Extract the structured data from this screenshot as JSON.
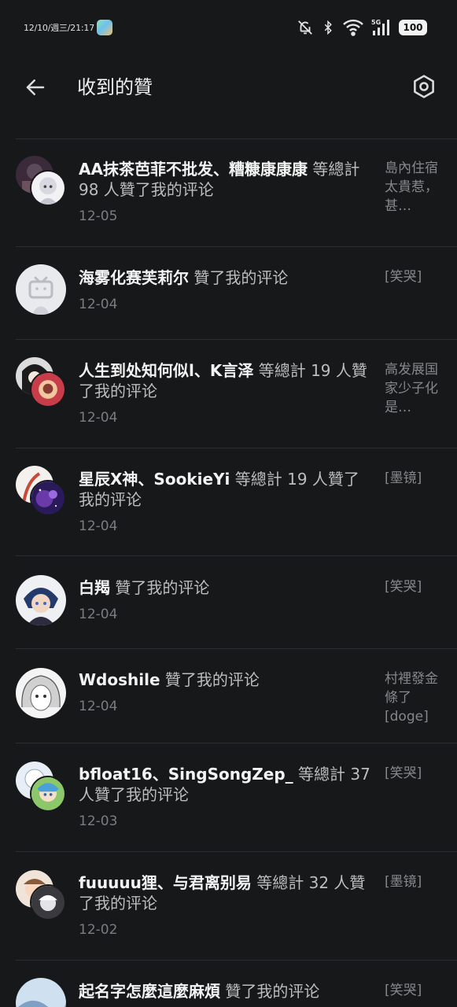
{
  "status_bar": {
    "time": "12/10/週三/21:17",
    "battery": "100",
    "network": "5G"
  },
  "header": {
    "title": "收到的贊",
    "back_icon": "arrow-left-icon",
    "settings_icon": "hexagon-settings-icon"
  },
  "items": [
    {
      "names": "AA抹茶芭菲不批发、糟糠康康康",
      "action": " 等總計 98 人贊了我的评论",
      "date": "12-05",
      "quote": "島內住宿太貴惹，甚…"
    },
    {
      "names": "海雾化赛芙莉尔",
      "action": " 贊了我的评论",
      "date": "12-04",
      "quote": "[笑哭]"
    },
    {
      "names": "人生到处知何似l、K言泽",
      "action": " 等總計 19 人贊了我的评论",
      "date": "12-04",
      "quote": "高发展国家少子化是…"
    },
    {
      "names": "星辰X神、SookieYi",
      "action": " 等總計 19 人贊了我的评论",
      "date": "12-04",
      "quote": "[墨镜]"
    },
    {
      "names": "白羯",
      "action": " 贊了我的评论",
      "date": "12-04",
      "quote": "[笑哭]"
    },
    {
      "names": "Wdoshile",
      "action": " 贊了我的评论",
      "date": "12-04",
      "quote": "村裡發金條了[doge]"
    },
    {
      "names": "bfloat16、SingSongZep_",
      "action": " 等總計 37 人贊了我的评论",
      "date": "12-03",
      "quote": "[笑哭]"
    },
    {
      "names": "fuuuuu狸、与君离别易",
      "action": " 等總計 32 人贊了我的评论",
      "date": "12-02",
      "quote": "[墨镜]"
    },
    {
      "names": "起名字怎麼這麼麻煩",
      "action": " 贊了我的评论",
      "date": "",
      "quote": "[笑哭]"
    }
  ]
}
